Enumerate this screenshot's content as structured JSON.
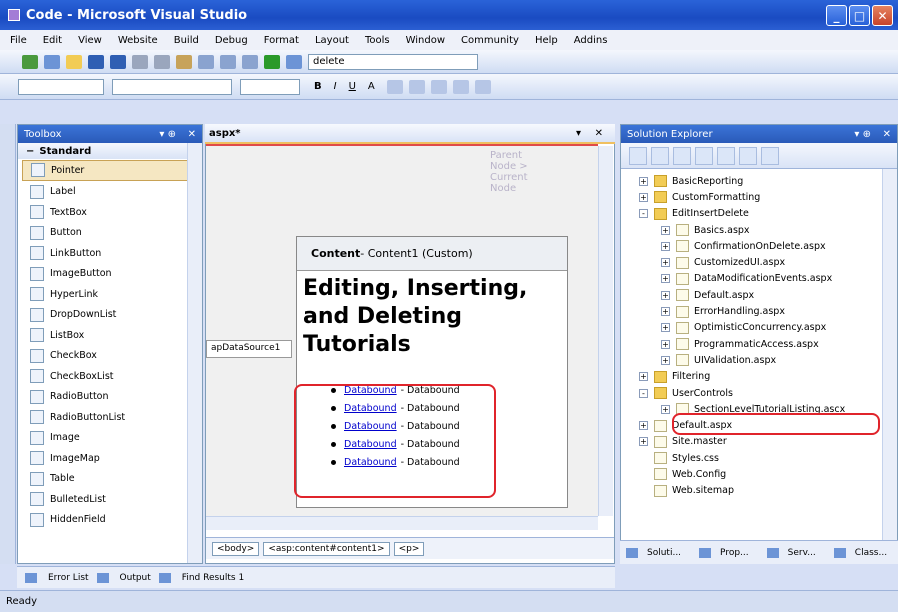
{
  "window": {
    "title": "Code - Microsoft Visual Studio"
  },
  "menu": [
    "File",
    "Edit",
    "View",
    "Website",
    "Build",
    "Debug",
    "Format",
    "Layout",
    "Tools",
    "Window",
    "Community",
    "Help",
    "Addins"
  ],
  "toolbar": {
    "find_value": "delete"
  },
  "toolbox": {
    "title": "Toolbox",
    "group": "Standard",
    "items": [
      "Pointer",
      "Label",
      "TextBox",
      "Button",
      "LinkButton",
      "ImageButton",
      "HyperLink",
      "DropDownList",
      "ListBox",
      "CheckBox",
      "CheckBoxList",
      "RadioButton",
      "RadioButtonList",
      "Image",
      "ImageMap",
      "Table",
      "BulletedList",
      "HiddenField"
    ],
    "item_icons": [
      "arrow",
      "A",
      "ab",
      "ab",
      "ab",
      "img",
      "A",
      "ddl",
      "lst",
      "chk",
      "chk",
      "rad",
      "rad",
      "img",
      "img",
      "tbl",
      "bul",
      "hid"
    ]
  },
  "designer": {
    "tab_label": "aspx*",
    "node_hint": [
      "Parent",
      "Node >",
      "Current",
      "Node"
    ],
    "datasource_label": "apDataSource1",
    "content_header": {
      "bold": "Content",
      "rest": " - Content1 (Custom)"
    },
    "heading": "Editing, Inserting, and Deleting Tutorials",
    "rows": [
      {
        "link": "Databound",
        "text": "- Databound"
      },
      {
        "link": "Databound",
        "text": "- Databound"
      },
      {
        "link": "Databound",
        "text": "- Databound"
      },
      {
        "link": "Databound",
        "text": "- Databound"
      },
      {
        "link": "Databound",
        "text": "- Databound"
      }
    ],
    "breadcrumbs": [
      "<body>",
      "<asp:content#content1>",
      "<p>"
    ]
  },
  "solution_explorer": {
    "title": "Solution Explorer",
    "nodes": [
      {
        "label": "BasicReporting",
        "type": "folder",
        "level": 0,
        "exp": "+"
      },
      {
        "label": "CustomFormatting",
        "type": "folder",
        "level": 0,
        "exp": "+"
      },
      {
        "label": "EditInsertDelete",
        "type": "folder",
        "level": 0,
        "exp": "-"
      },
      {
        "label": "Basics.aspx",
        "type": "page",
        "level": 1,
        "exp": "+"
      },
      {
        "label": "ConfirmationOnDelete.aspx",
        "type": "page",
        "level": 1,
        "exp": "+"
      },
      {
        "label": "CustomizedUI.aspx",
        "type": "page",
        "level": 1,
        "exp": "+"
      },
      {
        "label": "DataModificationEvents.aspx",
        "type": "page",
        "level": 1,
        "exp": "+"
      },
      {
        "label": "Default.aspx",
        "type": "page",
        "level": 1,
        "exp": "+"
      },
      {
        "label": "ErrorHandling.aspx",
        "type": "page",
        "level": 1,
        "exp": "+"
      },
      {
        "label": "OptimisticConcurrency.aspx",
        "type": "page",
        "level": 1,
        "exp": "+"
      },
      {
        "label": "ProgrammaticAccess.aspx",
        "type": "page",
        "level": 1,
        "exp": "+"
      },
      {
        "label": "UIValidation.aspx",
        "type": "page",
        "level": 1,
        "exp": "+"
      },
      {
        "label": "Filtering",
        "type": "folder",
        "level": 0,
        "exp": "+"
      },
      {
        "label": "UserControls",
        "type": "folder",
        "level": 0,
        "exp": "-"
      },
      {
        "label": "SectionLevelTutorialListing.ascx",
        "type": "page",
        "level": 1,
        "exp": "+"
      },
      {
        "label": "Default.aspx",
        "type": "page",
        "level": 0,
        "exp": "+"
      },
      {
        "label": "Site.master",
        "type": "page",
        "level": 0,
        "exp": "+"
      },
      {
        "label": "Styles.css",
        "type": "page",
        "level": 0,
        "exp": ""
      },
      {
        "label": "Web.Config",
        "type": "page",
        "level": 0,
        "exp": ""
      },
      {
        "label": "Web.sitemap",
        "type": "page",
        "level": 0,
        "exp": ""
      }
    ],
    "bottom_tabs": [
      "Soluti...",
      "Prop...",
      "Serv...",
      "Class..."
    ]
  },
  "output_tabs": [
    "Error List",
    "Output",
    "Find Results 1"
  ],
  "status": "Ready"
}
